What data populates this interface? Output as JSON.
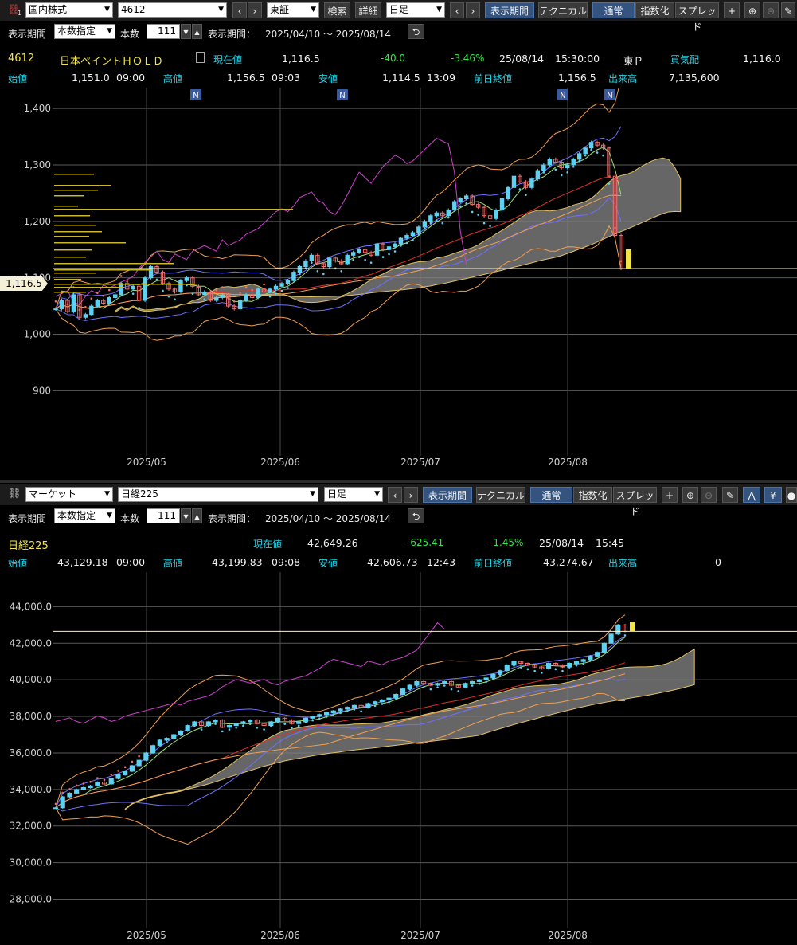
{
  "top": {
    "toolbar": {
      "market_select": "国内株式",
      "code_input": "4612",
      "exchange_select": "東証",
      "search_label": "検索",
      "detail_label": "詳細",
      "period_select": "日足",
      "display_period_btn": "表示期間",
      "technical_btn": "テクニカル",
      "normal_btn": "通常",
      "index_btn": "指数化",
      "spread_btn": "スプレッド"
    },
    "settings": {
      "display_period_label": "表示期間",
      "count_mode_select": "本数指定",
      "count_label": "本数",
      "count_value": "111",
      "range_label": "表示期間：",
      "range_value": "2025/04/10 ～ 2025/08/14"
    },
    "quote": {
      "code": "4612",
      "name": "日本ペイントＨＯＬＤ",
      "current_label": "現在値",
      "current_value": "1,116.5",
      "change": "-40.0",
      "change_pct": "-3.46%",
      "date": "25/08/14",
      "time": "15:30:00",
      "market": "東Ｐ",
      "bid_label": "買気配",
      "bid_value": "1,116.0",
      "open_label": "始値",
      "open_value": "1,151.0",
      "open_time": "09:00",
      "high_label": "高値",
      "high_value": "1,156.5",
      "high_time": "09:03",
      "low_label": "安値",
      "low_value": "1,114.5",
      "low_time": "13:09",
      "prev_label": "前日終値",
      "prev_value": "1,156.5",
      "volume_label": "出来高",
      "volume_value": "7,135,600"
    },
    "price_tag": "1,116.5",
    "news_marker": "N"
  },
  "bottom": {
    "toolbar": {
      "market_select": "マーケット",
      "index_select": "日経225",
      "period_select": "日足",
      "display_period_btn": "表示期間",
      "technical_btn": "テクニカル",
      "normal_btn": "通常",
      "index_btn": "指数化",
      "spread_btn": "スプレッド"
    },
    "settings": {
      "display_period_label": "表示期間",
      "count_mode_select": "本数指定",
      "count_label": "本数",
      "count_value": "111",
      "range_label": "表示期間：",
      "range_value": "2025/04/10 ～ 2025/08/14"
    },
    "quote": {
      "name": "日経225",
      "current_label": "現在値",
      "current_value": "42,649.26",
      "change": "-625.41",
      "change_pct": "-1.45%",
      "date": "25/08/14",
      "time": "15:45",
      "open_label": "始値",
      "open_value": "43,129.18",
      "open_time": "09:00",
      "high_label": "高値",
      "high_value": "43,199.83",
      "high_time": "09:08",
      "low_label": "安値",
      "low_value": "42,606.73",
      "low_time": "12:43",
      "prev_label": "前日終値",
      "prev_value": "43,274.67",
      "volume_label": "出来高",
      "volume_value": "0"
    }
  },
  "colors": {
    "up_candle": "#5ed0f0",
    "down_candle": "#f07070",
    "cloud": "#808080",
    "bollinger": "#f0a050",
    "span": "#d040d0",
    "quote_accent": "#1fd3e8",
    "name_accent": "#f2e54b",
    "change_color": "#38e24a"
  },
  "chart_data": [
    {
      "type": "line",
      "title": "",
      "series_kind": "candlestick",
      "y_ticks": [
        "1,400",
        "1,300",
        "1,200",
        "1,100",
        "1,000",
        "900"
      ],
      "ylim": [
        820,
        1420
      ],
      "x_ticks": [
        "2025/05",
        "2025/06",
        "2025/07",
        "2025/08"
      ],
      "news_dates": [
        "2025/05/13",
        "2025/06/25",
        "2025/08/05",
        "2025/08/12"
      ],
      "closes": [
        1045,
        1060,
        1040,
        1070,
        1030,
        1035,
        1050,
        1060,
        1055,
        1065,
        1070,
        1090,
        1080,
        1085,
        1060,
        1100,
        1120,
        1110,
        1090,
        1080,
        1075,
        1095,
        1100,
        1085,
        1070,
        1075,
        1060,
        1065,
        1070,
        1050,
        1045,
        1060,
        1070,
        1065,
        1080,
        1075,
        1080,
        1085,
        1090,
        1095,
        1110,
        1120,
        1130,
        1140,
        1125,
        1120,
        1135,
        1130,
        1125,
        1140,
        1145,
        1150,
        1145,
        1140,
        1160,
        1150,
        1155,
        1160,
        1170,
        1175,
        1180,
        1190,
        1200,
        1210,
        1215,
        1210,
        1220,
        1235,
        1240,
        1245,
        1230,
        1225,
        1210,
        1205,
        1220,
        1240,
        1260,
        1280,
        1270,
        1260,
        1275,
        1290,
        1300,
        1310,
        1305,
        1295,
        1300,
        1310,
        1320,
        1330,
        1340,
        1335,
        1330,
        1280,
        1175,
        1116.5
      ],
      "last_price": 1116.5
    },
    {
      "type": "line",
      "title": "",
      "series_kind": "candlestick",
      "y_ticks": [
        "44,000.0",
        "42,000.0",
        "40,000.0",
        "38,000.0",
        "36,000.0",
        "34,000.0",
        "32,000.0",
        "30,000.0",
        "28,000.0"
      ],
      "ylim": [
        27500,
        44800
      ],
      "x_ticks": [
        "2025/05",
        "2025/06",
        "2025/07",
        "2025/08"
      ],
      "closes": [
        33000,
        33600,
        33800,
        34000,
        34100,
        34200,
        34400,
        34300,
        34600,
        34800,
        35000,
        35300,
        35600,
        36000,
        36400,
        36700,
        36800,
        37000,
        37200,
        37500,
        37700,
        37500,
        37700,
        37800,
        37400,
        37500,
        37600,
        37700,
        37800,
        37600,
        37500,
        37700,
        37900,
        37800,
        37600,
        37700,
        37900,
        38000,
        38100,
        38200,
        38300,
        38400,
        38500,
        38600,
        38500,
        38700,
        38800,
        38900,
        39000,
        39200,
        39500,
        39700,
        39900,
        39800,
        39700,
        39800,
        39900,
        39700,
        39600,
        39800,
        39900,
        40000,
        40100,
        40300,
        40500,
        40800,
        41000,
        40900,
        40800,
        40700,
        40600,
        40900,
        40800,
        40700,
        40900,
        41000,
        41100,
        41300,
        41500,
        42000,
        42500,
        43000,
        42650
      ],
      "last_price": 42649.26
    }
  ]
}
